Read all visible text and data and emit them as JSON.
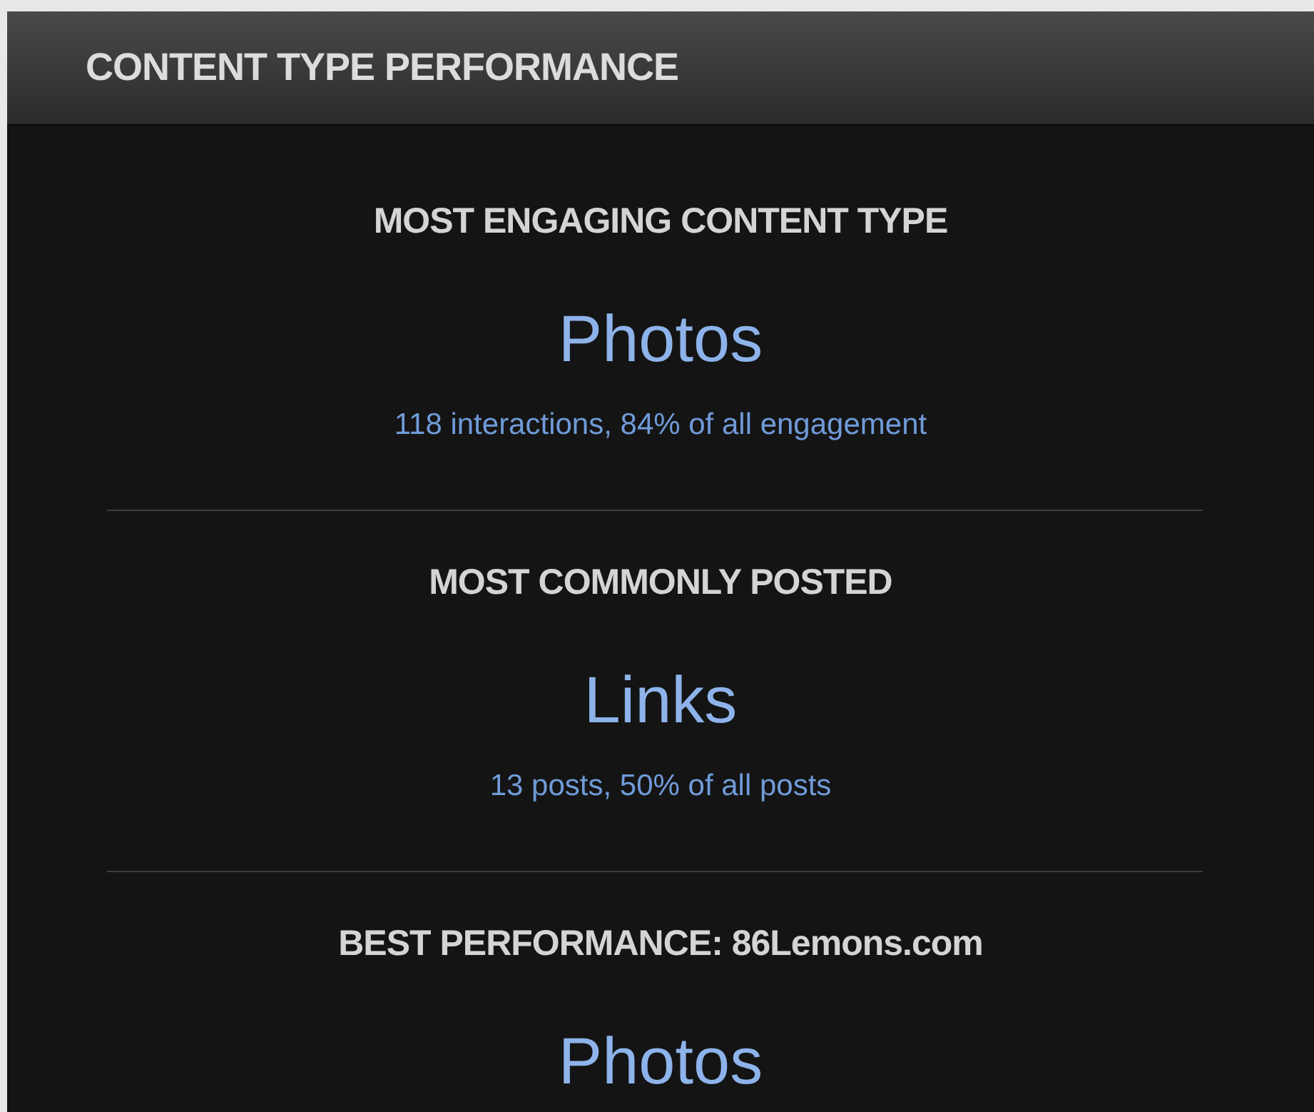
{
  "panel": {
    "title": "CONTENT TYPE PERFORMANCE"
  },
  "sections": [
    {
      "heading": "MOST ENGAGING CONTENT TYPE",
      "value": "Photos",
      "detail": "118 interactions, 84% of all engagement"
    },
    {
      "heading": "MOST COMMONLY POSTED",
      "value": "Links",
      "detail": "13 posts, 50% of all posts"
    },
    {
      "heading": "BEST PERFORMANCE: 86Lemons.com",
      "value": "Photos"
    }
  ]
}
